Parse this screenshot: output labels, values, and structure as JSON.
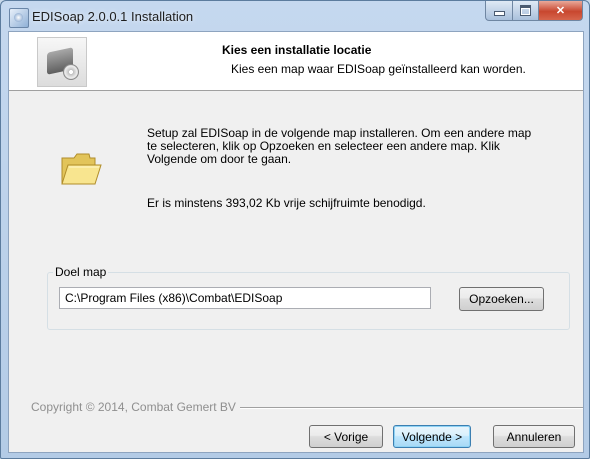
{
  "window": {
    "title": "EDISoap 2.0.0.1 Installation",
    "icon": "installer-app-icon"
  },
  "header": {
    "title": "Kies een installatie locatie",
    "subtitle": "Kies een map waar EDISoap geïnstalleerd kan worden.",
    "icon": "hard-drive-disc-icon"
  },
  "body": {
    "instructions": "Setup zal EDISoap in de volgende map installeren. Om een andere map te selecteren, klik op Opzoeken en selecteer een andere map. Klik Volgende om door te gaan.",
    "space_required": "Er is minstens 393,02 Kb vrije schijfruimte benodigd.",
    "folder_icon": "folder-icon"
  },
  "destination": {
    "group_label": "Doel map",
    "path_value": "C:\\Program Files (x86)\\Combat\\EDISoap",
    "browse_label": "Opzoeken..."
  },
  "footer": {
    "copyright": "Copyright © 2014, Combat Gemert BV",
    "back_label": "< Vorige",
    "next_label": "Volgende >",
    "cancel_label": "Annuleren"
  },
  "colors": {
    "title_bar": "#c5d8ef",
    "close_button": "#c8472f",
    "dialog_background": "#f0f0f0",
    "default_button_border": "#3c7fb1"
  }
}
